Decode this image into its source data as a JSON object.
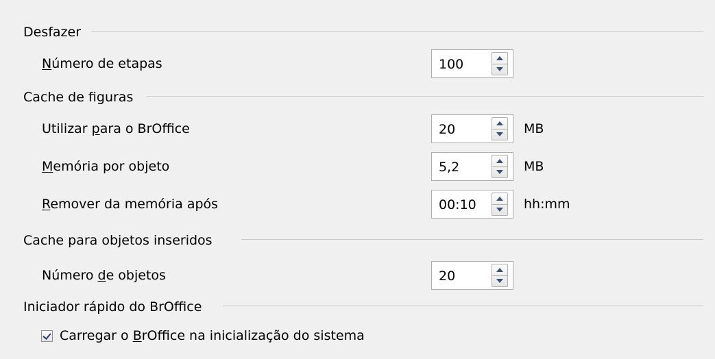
{
  "undo": {
    "title": "Desfazer",
    "steps_label_u": "N",
    "steps_label_rest": "úmero de etapas",
    "steps_value": "100"
  },
  "graphics_cache": {
    "title": "Cache de figuras",
    "use_label_a": "Utilizar ",
    "use_label_u": "p",
    "use_label_b": "ara o BrOffice",
    "use_value": "20",
    "use_unit": "MB",
    "per_object_label_u": "M",
    "per_object_label_rest": "emória por objeto",
    "per_object_value": "5,2",
    "per_object_unit": "MB",
    "remove_label_u": "R",
    "remove_label_rest": "emover da memória após",
    "remove_value": "00:10",
    "remove_unit": "hh:mm"
  },
  "object_cache": {
    "title": "Cache para objetos inseridos",
    "count_label_a": "Número ",
    "count_label_u": "d",
    "count_label_b": "e objetos",
    "count_value": "20"
  },
  "quickstarter": {
    "title": "Iniciador rápido do BrOffice",
    "load_label_a": "Carregar o ",
    "load_label_u": "B",
    "load_label_b": "rOffice na inicialização do sistema",
    "load_checked": true
  },
  "icons": {
    "spin_up": "triangle-up-icon",
    "spin_down": "triangle-down-icon",
    "check": "checkmark-icon"
  }
}
